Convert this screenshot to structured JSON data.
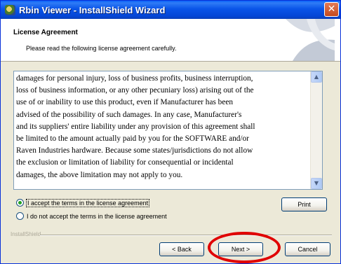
{
  "window": {
    "title": "Rbin Viewer - InstallShield Wizard",
    "close_glyph": "✕"
  },
  "header": {
    "title": "License Agreement",
    "subtitle": "Please read the following license agreement carefully."
  },
  "license": {
    "lines": [
      "damages for personal injury, loss of business profits, business interruption,",
      "loss of business information, or any other pecuniary loss) arising out of the",
      "use of or inability to use this product, even if Manufacturer has been",
      "advised of the possibility of such damages.  In any case, Manufacturer's",
      "and its suppliers' entire liability under any provision of this agreement shall",
      "be limited to the amount actually paid by you for the SOFTWARE and/or",
      "Raven Industries hardware.  Because some states/jurisdictions do not allow",
      "the exclusion or limitation of liability for consequential or incidental",
      "damages, the above limitation may not apply to you."
    ],
    "scroll_up_glyph": "▲",
    "scroll_down_glyph": "▼"
  },
  "options": {
    "accept": {
      "label": "I accept the terms in the license agreement",
      "selected": true
    },
    "decline": {
      "label": "I do not accept the terms in the license agreement",
      "selected": false
    }
  },
  "buttons": {
    "print": "Print",
    "back": "< Back",
    "next": "Next >",
    "cancel": "Cancel"
  },
  "footer": {
    "brand": "InstallShield"
  },
  "colors": {
    "titlebar": "#0a54e8",
    "highlight_ring": "#e00000",
    "dialog_bg": "#ece9d8"
  },
  "icons": {
    "app": "rbin-viewer-app-icon",
    "close": "close-icon",
    "header_graphic": "installshield-swirl-graphic"
  }
}
